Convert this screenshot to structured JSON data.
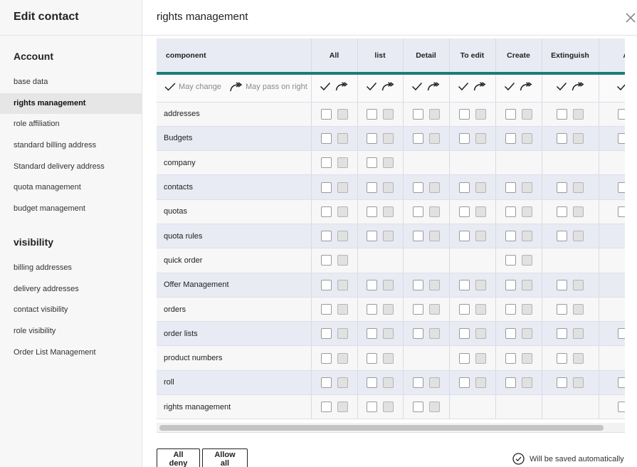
{
  "sidebar": {
    "title": "Edit contact",
    "sections": [
      {
        "title": "Account",
        "items": [
          {
            "label": "base data",
            "active": false
          },
          {
            "label": "rights management",
            "active": true
          },
          {
            "label": "role affiliation",
            "active": false
          },
          {
            "label": "standard billing address",
            "active": false
          },
          {
            "label": "Standard delivery address",
            "active": false
          },
          {
            "label": "quota management",
            "active": false
          },
          {
            "label": "budget management",
            "active": false
          }
        ]
      },
      {
        "title": "visibility",
        "items": [
          {
            "label": "billing addresses",
            "active": false
          },
          {
            "label": "delivery addresses",
            "active": false
          },
          {
            "label": "contact visibility",
            "active": false
          },
          {
            "label": "role visibility",
            "active": false
          },
          {
            "label": "Order List Management",
            "active": false
          }
        ]
      }
    ]
  },
  "header": {
    "title": "rights management",
    "close_icon": "close-icon"
  },
  "grid": {
    "component_header": "component",
    "columns": [
      "All",
      "list",
      "Detail",
      "To edit",
      "Create",
      "Extinguish",
      "Assi"
    ],
    "legend": {
      "may_change": "May change",
      "may_pass": "May pass on right"
    },
    "rows": [
      {
        "label": "addresses",
        "cells": [
          1,
          1,
          1,
          1,
          1,
          1,
          1
        ]
      },
      {
        "label": "Budgets",
        "cells": [
          1,
          1,
          1,
          1,
          1,
          1,
          1
        ]
      },
      {
        "label": "company",
        "cells": [
          1,
          1,
          0,
          0,
          0,
          0,
          0
        ]
      },
      {
        "label": "contacts",
        "cells": [
          1,
          1,
          1,
          1,
          1,
          1,
          1
        ]
      },
      {
        "label": "quotas",
        "cells": [
          1,
          1,
          1,
          1,
          1,
          1,
          1
        ]
      },
      {
        "label": "quota rules",
        "cells": [
          1,
          1,
          1,
          1,
          1,
          1,
          0
        ]
      },
      {
        "label": "quick order",
        "cells": [
          1,
          0,
          0,
          0,
          1,
          0,
          0
        ]
      },
      {
        "label": "Offer Management",
        "cells": [
          1,
          1,
          1,
          1,
          1,
          1,
          0
        ]
      },
      {
        "label": "orders",
        "cells": [
          1,
          1,
          1,
          1,
          1,
          1,
          0
        ]
      },
      {
        "label": "order lists",
        "cells": [
          1,
          1,
          1,
          1,
          1,
          1,
          1
        ]
      },
      {
        "label": "product numbers",
        "cells": [
          1,
          1,
          0,
          1,
          1,
          1,
          0
        ]
      },
      {
        "label": "roll",
        "cells": [
          1,
          1,
          1,
          1,
          1,
          1,
          1
        ]
      },
      {
        "label": "rights management",
        "cells": [
          1,
          1,
          1,
          0,
          0,
          0,
          1
        ]
      }
    ]
  },
  "footer": {
    "deny_all": "All deny",
    "allow_all": "Allow all",
    "autosave": "Will be saved automatically"
  },
  "colors": {
    "accent": "#1d7a7a",
    "header_bg": "#e8ebf3"
  }
}
